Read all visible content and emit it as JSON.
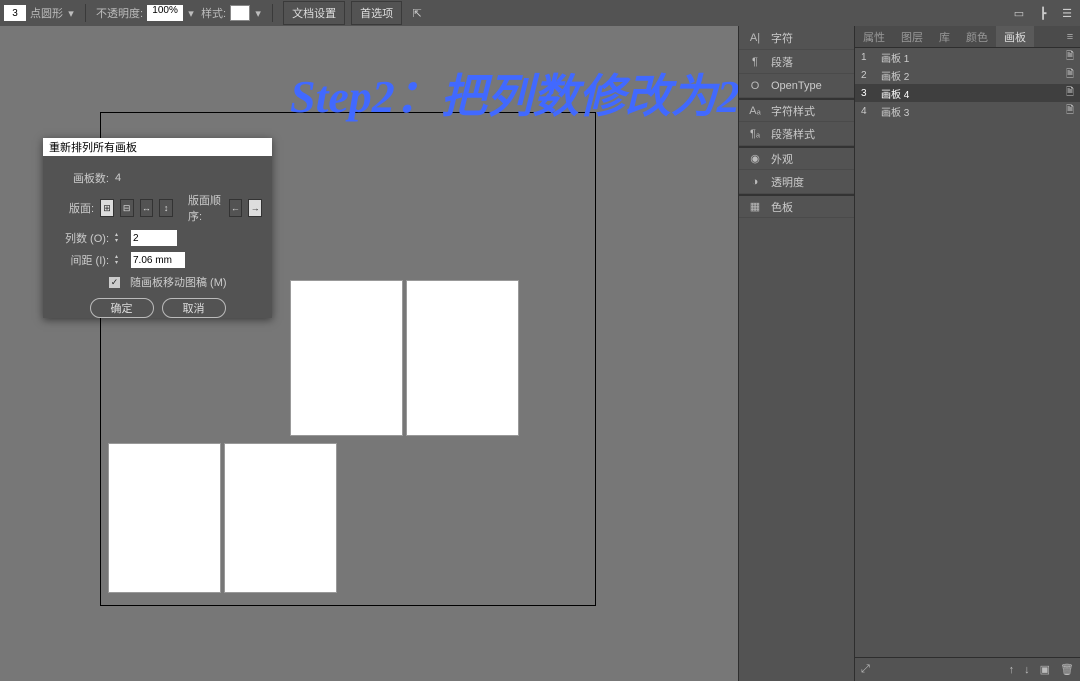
{
  "topbar": {
    "stroke_weight": "3",
    "stroke_label": "点圆形",
    "opacity_label": "不透明度:",
    "opacity_value": "100%",
    "style_label": "样式:",
    "doc_settings": "文档设置",
    "preferences": "首选项"
  },
  "annotation": "Step2：把列数修改为2",
  "dialog": {
    "title": "重新排列所有画板",
    "artboard_count_label": "画板数:",
    "artboard_count_value": "4",
    "layout_label": "版面:",
    "order_label": "版面顺序:",
    "cols_label": "列数 (O):",
    "cols_value": "2",
    "spacing_label": "间距 (I):",
    "spacing_value": "7.06 mm",
    "move_art_label": "随画板移动图稿 (M)",
    "ok": "确定",
    "cancel": "取消"
  },
  "side_panels": [
    {
      "icon": "A|",
      "label": "字符"
    },
    {
      "icon": "¶",
      "label": "段落"
    },
    {
      "icon": "O",
      "label": "OpenType"
    },
    {
      "icon": "Aₐ",
      "label": "字符样式"
    },
    {
      "icon": "¶ₐ",
      "label": "段落样式"
    },
    {
      "icon": "◉",
      "label": "外观"
    },
    {
      "icon": "◑",
      "label": "透明度"
    },
    {
      "icon": "▦",
      "label": "色板"
    }
  ],
  "right_tabs": [
    "属性",
    "图层",
    "库",
    "颜色",
    "画板"
  ],
  "active_tab": 4,
  "artboards_list": [
    {
      "num": "1",
      "name": "画板 1"
    },
    {
      "num": "2",
      "name": "画板 2"
    },
    {
      "num": "3",
      "name": "画板 4"
    },
    {
      "num": "4",
      "name": "画板 3"
    }
  ],
  "selected_artboard": 2
}
